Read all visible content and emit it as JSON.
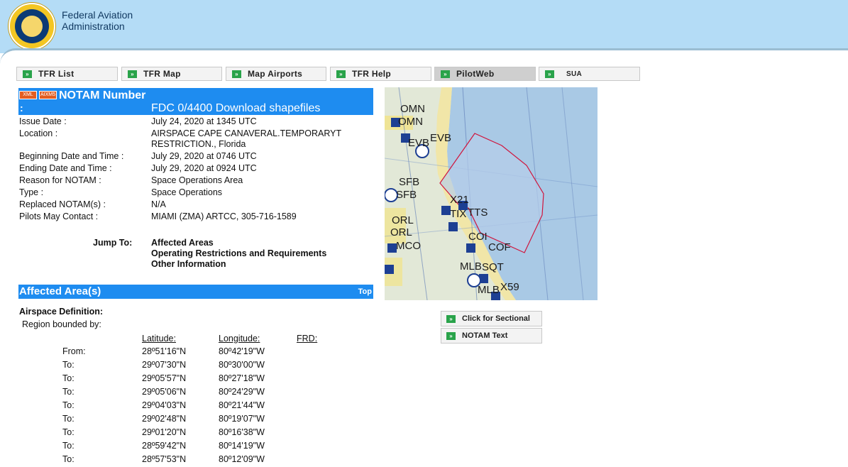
{
  "header": {
    "org_line1": "Federal Aviation",
    "org_line2": "Administration",
    "logo_icon": "faa-seal-icon"
  },
  "nav": {
    "tabs": [
      {
        "label": "TFR List"
      },
      {
        "label": "TFR Map"
      },
      {
        "label": "Map Airports"
      },
      {
        "label": "TFR Help"
      },
      {
        "label": "PilotWeb",
        "active": true
      },
      {
        "label": "SUA"
      }
    ]
  },
  "notam": {
    "badge_xml": "XML",
    "badge_aixm": "AIXM5",
    "title": "NOTAM Number",
    "colon": ":",
    "number": "FDC 0/4400",
    "download": "Download shapefiles",
    "fields": [
      {
        "label": "Issue Date :",
        "value": "July 24, 2020 at 1345 UTC"
      },
      {
        "label": "Location :",
        "value": "AIRSPACE CAPE CANAVERAL.TEMPORARYT",
        "value2": "RESTRICTION., Florida"
      },
      {
        "label": "Beginning Date and Time :",
        "value": "July 29, 2020 at 0746 UTC"
      },
      {
        "label": "Ending Date and Time :",
        "value": "July 29, 2020 at 0924 UTC"
      },
      {
        "label": "Reason for NOTAM :",
        "value": "Space Operations Area"
      },
      {
        "label": "Type :",
        "value": "Space Operations"
      },
      {
        "label": "Replaced NOTAM(s) :",
        "value": "N/A"
      },
      {
        "label": "Pilots May Contact :",
        "value": "MIAMI (ZMA) ARTCC, 305-716-1589"
      }
    ]
  },
  "jump": {
    "label": "Jump To:",
    "links": [
      "Affected Areas",
      "Operating Restrictions and Requirements",
      "Other Information"
    ]
  },
  "affected": {
    "title": "Affected Area(s)",
    "top_link": "Top",
    "airspace_def": "Airspace Definition:",
    "region": "Region bounded by:",
    "headers": {
      "lat": "Latitude:",
      "lon": "Longitude:",
      "frd": "FRD:"
    },
    "rows": [
      {
        "label": "From:",
        "lat": "28º51'16\"N",
        "lon": "80º42'19\"W"
      },
      {
        "label": "To:",
        "lat": "29º07'30\"N",
        "lon": "80º30'00\"W"
      },
      {
        "label": "To:",
        "lat": "29º05'57\"N",
        "lon": "80º27'18\"W"
      },
      {
        "label": "To:",
        "lat": "29º05'06\"N",
        "lon": "80º24'29\"W"
      },
      {
        "label": "To:",
        "lat": "29º04'03\"N",
        "lon": "80º21'44\"W"
      },
      {
        "label": "To:",
        "lat": "29º02'48\"N",
        "lon": "80º19'07\"W"
      },
      {
        "label": "To:",
        "lat": "29º01'20\"N",
        "lon": "80º16'38\"W"
      },
      {
        "label": "To:",
        "lat": "28º59'42\"N",
        "lon": "80º14'19\"W"
      },
      {
        "label": "To:",
        "lat": "28º57'53\"N",
        "lon": "80º12'09\"W"
      }
    ]
  },
  "map": {
    "labels": [
      "OMN",
      "OMN",
      "EVB",
      "EVB",
      "SFB",
      "SFB",
      "X21",
      "TIX",
      "TTS",
      "ORL",
      "ORL",
      "COI",
      "MCO",
      "COF",
      "MLB",
      "SQT",
      "MLB",
      "X59"
    ],
    "tfr_color": "#d0143c",
    "water_color": "#9fc3e8"
  },
  "side_buttons": {
    "sectional": "Click for Sectional",
    "notam_text": "NOTAM Text"
  }
}
